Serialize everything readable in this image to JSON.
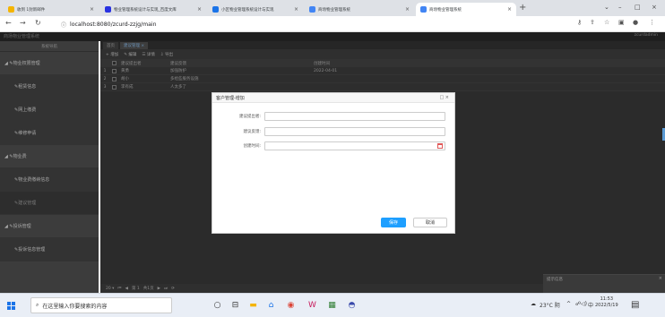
{
  "browser": {
    "tabs": [
      {
        "title": "收到 1封新邮件",
        "active": false,
        "color": "#f4b400"
      },
      {
        "title": "物业管理系统设计与实现_百度文库",
        "active": false,
        "color": "#2932e1"
      },
      {
        "title": "小区物业管理系统设计与实现",
        "active": false,
        "color": "#1a73e8"
      },
      {
        "title": "商场物业管理系统",
        "active": false,
        "color": "#4285f4"
      },
      {
        "title": "商场物业管理系统",
        "active": true,
        "color": "#4285f4"
      }
    ],
    "url": "localhost:8080/zcurd-zzjg/main"
  },
  "app": {
    "title": "商场物业管理系统",
    "user": "zcurdadmin"
  },
  "sidebar": {
    "header": "系统导航",
    "items": [
      {
        "label": "物业权限管理",
        "type": "group"
      },
      {
        "label": "租赁信息",
        "type": "sub"
      },
      {
        "label": "网上缴费",
        "type": "sub"
      },
      {
        "label": "维修申请",
        "type": "sub"
      },
      {
        "label": "物业费",
        "type": "group"
      },
      {
        "label": "物业费缴纳信息",
        "type": "sub"
      },
      {
        "label": "建议管理",
        "type": "sub",
        "selected": true
      },
      {
        "label": "投诉管理",
        "type": "group"
      },
      {
        "label": "投诉信息管理",
        "type": "sub"
      }
    ]
  },
  "main": {
    "tabs": [
      "首页",
      "建议管理"
    ],
    "toolbar": [
      "+ 增加",
      "✎ 编辑",
      "☰ 详情",
      "⇩ 导出"
    ],
    "columns": [
      "建议提出者",
      "建议反馈",
      "创建时间"
    ],
    "rows": [
      {
        "n": "1",
        "a": "黄勇",
        "b": "加强防护",
        "c": "2022-04-01"
      },
      {
        "n": "2",
        "a": "胡小",
        "b": "多给些服务设施",
        "c": ""
      },
      {
        "n": "3",
        "a": "李有成",
        "b": "人太多了",
        "c": ""
      }
    ],
    "pager": [
      "20 ▾",
      "⏮",
      "◀",
      "第 1",
      "共1页",
      "▶",
      "⏭",
      "⟳"
    ]
  },
  "notification": {
    "title": "提示信息",
    "close": "×"
  },
  "dialog": {
    "title": "客户管理-增加",
    "controls": "□ ×",
    "fields": [
      {
        "label": "建议提出者:",
        "value": ""
      },
      {
        "label": "建议反馈:",
        "value": ""
      },
      {
        "label": "创建时间:",
        "value": ""
      }
    ],
    "save_label": "保存",
    "cancel_label": "取消"
  },
  "taskbar": {
    "search_placeholder": "在这里输入你要搜索的内容",
    "weather": "23°C 阴",
    "ime": "中",
    "time": "11:53",
    "date": "2022/5/19"
  }
}
